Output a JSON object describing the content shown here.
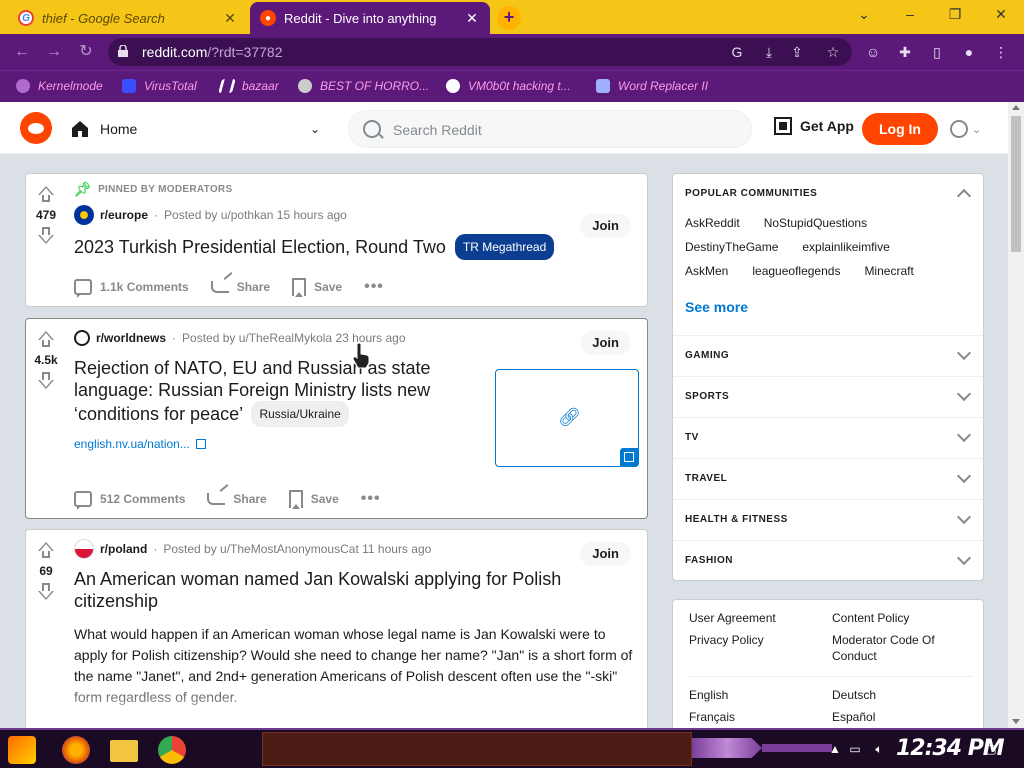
{
  "browser": {
    "tabs": [
      {
        "title": "thief - Google Search",
        "active": false
      },
      {
        "title": "Reddit - Dive into anything",
        "active": true
      }
    ],
    "new_tab": "+",
    "url_host": "reddit.com",
    "url_rest": "/?rdt=37782",
    "bookmarks": [
      {
        "label": "Kernelmode",
        "icon_color": "#b06ad0"
      },
      {
        "label": "VirusTotal",
        "icon_color": "#394eff"
      },
      {
        "label": "bazaar",
        "icon_color": "#ffffff"
      },
      {
        "label": "BEST OF HORRO...",
        "icon_color": "#cccccc"
      },
      {
        "label": "VM0b0t hacking t...",
        "icon_color": "#ffffff"
      },
      {
        "label": "Word Replacer II",
        "icon_color": "#9fb0ff"
      }
    ]
  },
  "header": {
    "home_label": "Home",
    "search_placeholder": "Search Reddit",
    "get_app": "Get App",
    "login": "Log In"
  },
  "posts": [
    {
      "pinned_label": "PINNED BY MODERATORS",
      "score": "479",
      "subreddit": "r/europe",
      "posted_by": "Posted by u/pothkan",
      "time": "15 hours ago",
      "join": "Join",
      "title": "2023 Turkish Presidential Election, Round Two",
      "flair": "TR Megathread",
      "comments": "1.1k Comments",
      "share": "Share",
      "save": "Save"
    },
    {
      "score": "4.5k",
      "subreddit": "r/worldnews",
      "posted_by": "Posted by u/TheRealMykola",
      "time": "23 hours ago",
      "join": "Join",
      "title": "Rejection of NATO, EU and Russian as state language: Russian Foreign Ministry lists new ‘conditions for peace’",
      "flair": "Russia/Ukraine",
      "link": "english.nv.ua/nation...",
      "comments": "512 Comments",
      "share": "Share",
      "save": "Save"
    },
    {
      "score": "69",
      "subreddit": "r/poland",
      "posted_by": "Posted by u/TheMostAnonymousCat",
      "time": "11 hours ago",
      "join": "Join",
      "title": "An American woman named Jan Kowalski applying for Polish citizenship",
      "body": "What would happen if an American woman whose legal name is Jan Kowalski were to apply for Polish citizenship? Would she need to change her name? \"Jan\" is a short form of the name \"Janet\", and 2nd+ generation Americans of Polish descent often use the \"-ski\" form regardless of gender."
    }
  ],
  "sidebar": {
    "popular_title": "POPULAR COMMUNITIES",
    "communities": [
      "AskReddit",
      "NoStupidQuestions",
      "DestinyTheGame",
      "explainlikeimfive",
      "AskMen",
      "leagueoflegends",
      "Minecraft"
    ],
    "see_more": "See more",
    "categories": [
      "GAMING",
      "SPORTS",
      "TV",
      "TRAVEL",
      "HEALTH & FITNESS",
      "FASHION"
    ],
    "footer_links": {
      "user_agreement": "User Agreement",
      "content_policy": "Content Policy",
      "privacy_policy": "Privacy Policy",
      "moderator_code": "Moderator Code Of Conduct",
      "english": "English",
      "deutsch": "Deutsch",
      "francais": "Français",
      "espanol": "Español"
    }
  },
  "taskbar": {
    "clock": "12:34 PM"
  },
  "colors": {
    "reddit_orange": "#ff4500",
    "chrome_theme": "#5b1a7a",
    "tab_strip": "#f5c518",
    "link_blue": "#0079d3",
    "megathread_flair": "#0b3d91"
  }
}
